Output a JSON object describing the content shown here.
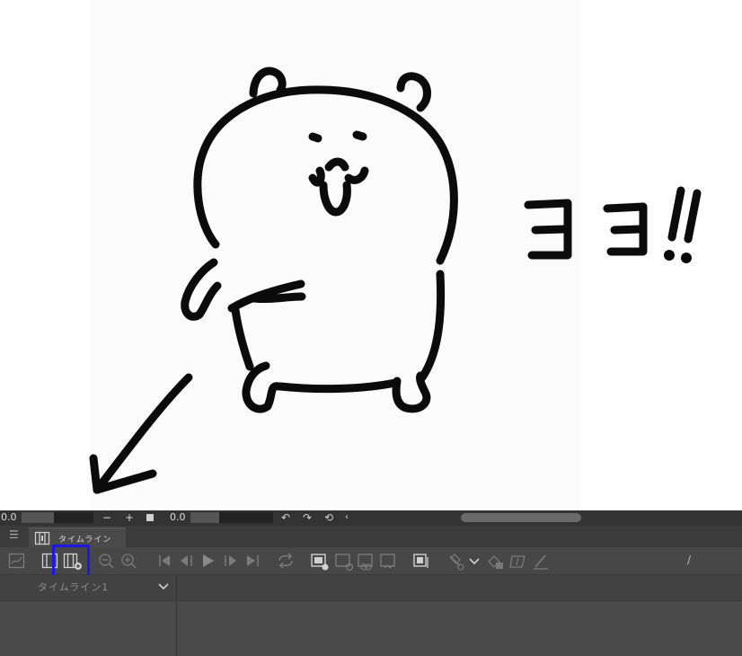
{
  "canvas": {
    "annotation_text": "ココ!!"
  },
  "timeline": {
    "left_value": "0.0",
    "right_value": "0.0",
    "minus": "−",
    "plus": "+",
    "tab_label": "タイムライン",
    "track_name": "タイムライン1",
    "toolbar_right_text": "/",
    "highlight_color": "#1a1ae6",
    "icons": [
      "graph-icon",
      "timeline-icon",
      "new-timeline-icon",
      "zoom-out-icon",
      "zoom-in-icon",
      "first-frame-icon",
      "prev-frame-icon",
      "play-icon",
      "next-frame-icon",
      "last-frame-icon",
      "loop-icon",
      "new-animation-folder-icon",
      "new-cel-icon",
      "specify-cel-icon",
      "frame-icon",
      "onion-skin-icon",
      "keyframe-icon",
      "dropdown-icon",
      "fill-cel-icon",
      "clear-cel-icon",
      "pen-icon"
    ]
  }
}
